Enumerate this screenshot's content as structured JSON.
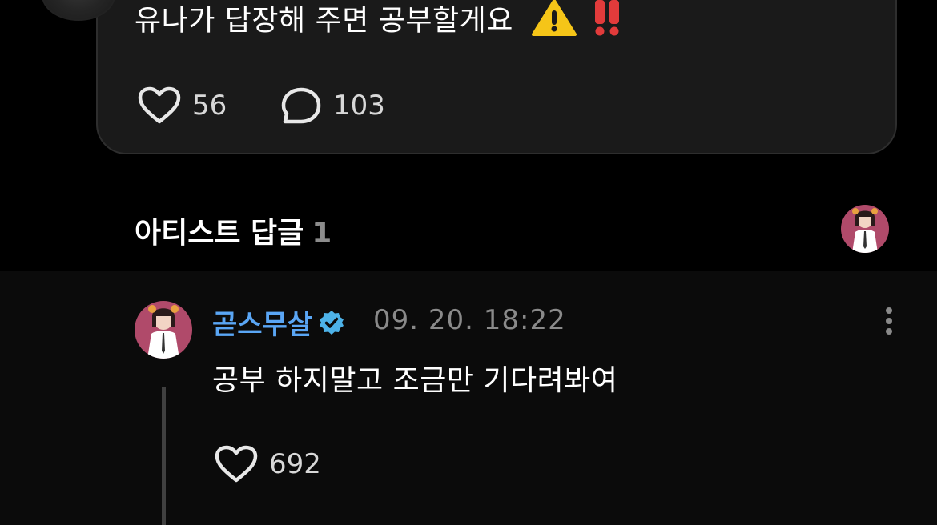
{
  "post": {
    "text": "유나가 답장해 주면 공부할게요",
    "likes": "56",
    "comments": "103"
  },
  "artist_replies": {
    "title": "아티스트 답글",
    "count": "1"
  },
  "reply": {
    "author": "곧스무살",
    "timestamp": "09. 20. 18:22",
    "text": "공부 하지말고 조금만 기다려봐여",
    "likes": "692"
  },
  "colors": {
    "background": "#000000",
    "card": "#1a1a1a",
    "reply_background": "#0b0b0b",
    "author_name": "#5aa6f5",
    "verified_badge": "#4db2e8",
    "muted_text": "#8a8a8a",
    "warning_yellow": "#f5c518",
    "exclamation_red": "#e23b3b"
  },
  "icons": {
    "like": "heart-outline-icon",
    "comment": "speech-bubble-icon",
    "verified": "verified-badge-icon",
    "more": "more-vertical-icon",
    "warning": "warning-emoji-icon",
    "double_exclamation": "double-exclamation-emoji-icon"
  }
}
